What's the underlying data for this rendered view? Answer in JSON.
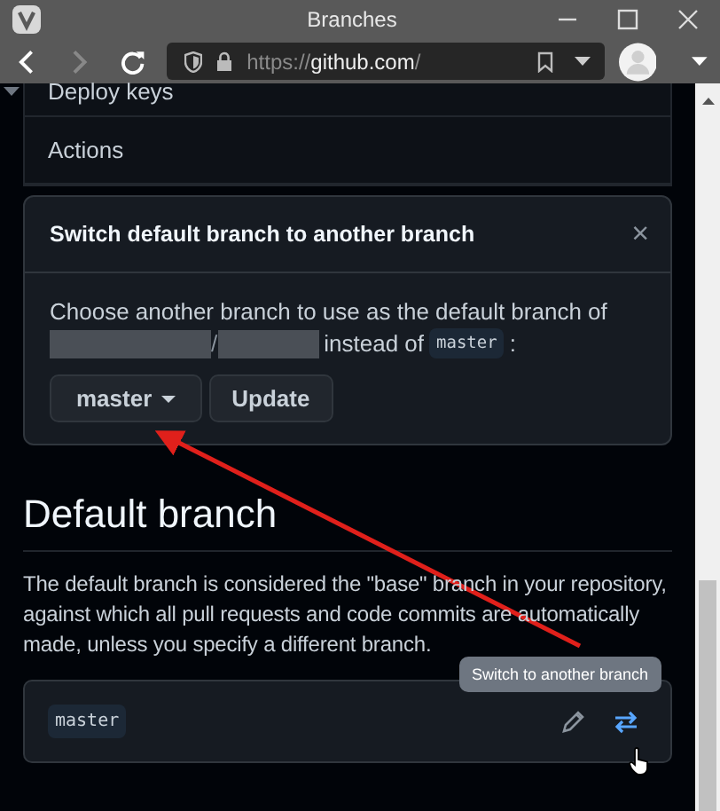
{
  "window": {
    "title": "Branches"
  },
  "address_bar": {
    "scheme": "https://",
    "host": "github.com",
    "path": "/"
  },
  "settings_menu": [
    {
      "label": "Deploy keys"
    },
    {
      "label": "Actions"
    }
  ],
  "dialog": {
    "title": "Switch default branch to another branch",
    "close": "×",
    "text_before": "Choose another branch to use as the default branch of",
    "separator": "/",
    "text_after": "instead of",
    "current_branch": "master",
    "text_end": ":",
    "branch_select": "master",
    "update_button": "Update"
  },
  "section": {
    "heading": "Default branch",
    "description": "The default branch is considered the \"base\" branch in your repository, against which all pull requests and code commits are automatically made, unless you specify a different branch.",
    "branch": "master",
    "tooltip": "Switch to another branch"
  }
}
